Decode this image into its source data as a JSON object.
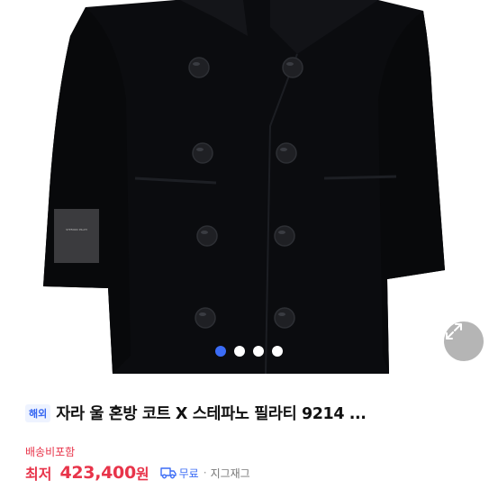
{
  "gallery": {
    "image_alt": "black double-breasted wool coat product photo",
    "label_patch_text": "STEFANO PILATI",
    "dots_total": 4,
    "active_dot": 0
  },
  "product": {
    "badge": "해외",
    "title": "자라 울 혼방 코트 X 스테파노 필라티 9214 ...",
    "shipping_note": "배송비포함",
    "price_label": "최저",
    "price": "423,400",
    "price_unit": "원",
    "delivery_label": "무료",
    "separator": "·",
    "payment_label": "지그재그"
  },
  "colors": {
    "accent_blue": "#3b6cf6",
    "price_red": "#e8344a"
  }
}
